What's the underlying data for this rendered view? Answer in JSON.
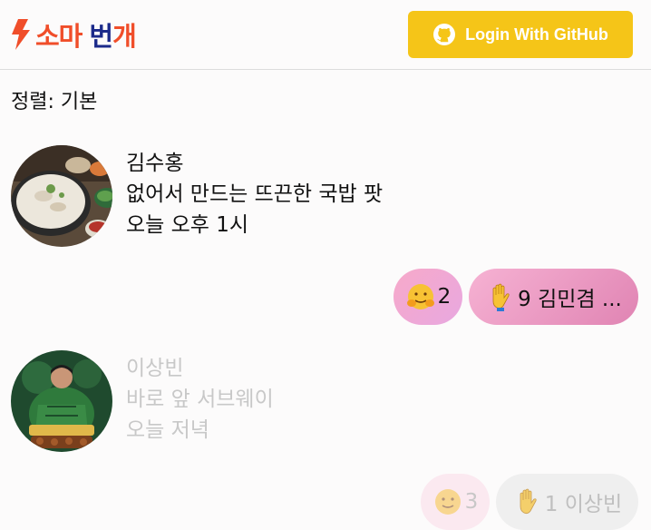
{
  "header": {
    "logo_part1": "소마",
    "logo_part2": "번",
    "logo_part3": "개",
    "login_label": "Login With GitHub"
  },
  "sort_label": "정렬: 기본",
  "posts": [
    {
      "author": "김수홍",
      "title": "없어서 만드는 뜨끈한 국밥 팟",
      "time": "오늘 오후 1시",
      "reactions": [
        {
          "icon": "hug-face-emoji",
          "count": "2"
        },
        {
          "icon": "raised-hand-emoji",
          "text": "9 김민겸 ..."
        }
      ]
    },
    {
      "author": "이상빈",
      "title": "바로 앞 서브웨이",
      "time": "오늘 저녁",
      "reactions": [
        {
          "icon": "hug-face-emoji",
          "count": "3"
        },
        {
          "icon": "raised-hand-emoji",
          "text": "1 이상빈"
        }
      ]
    }
  ],
  "colors": {
    "accent": "#f04e2a",
    "navy": "#1b2a8a",
    "github_button": "#f5c518"
  }
}
